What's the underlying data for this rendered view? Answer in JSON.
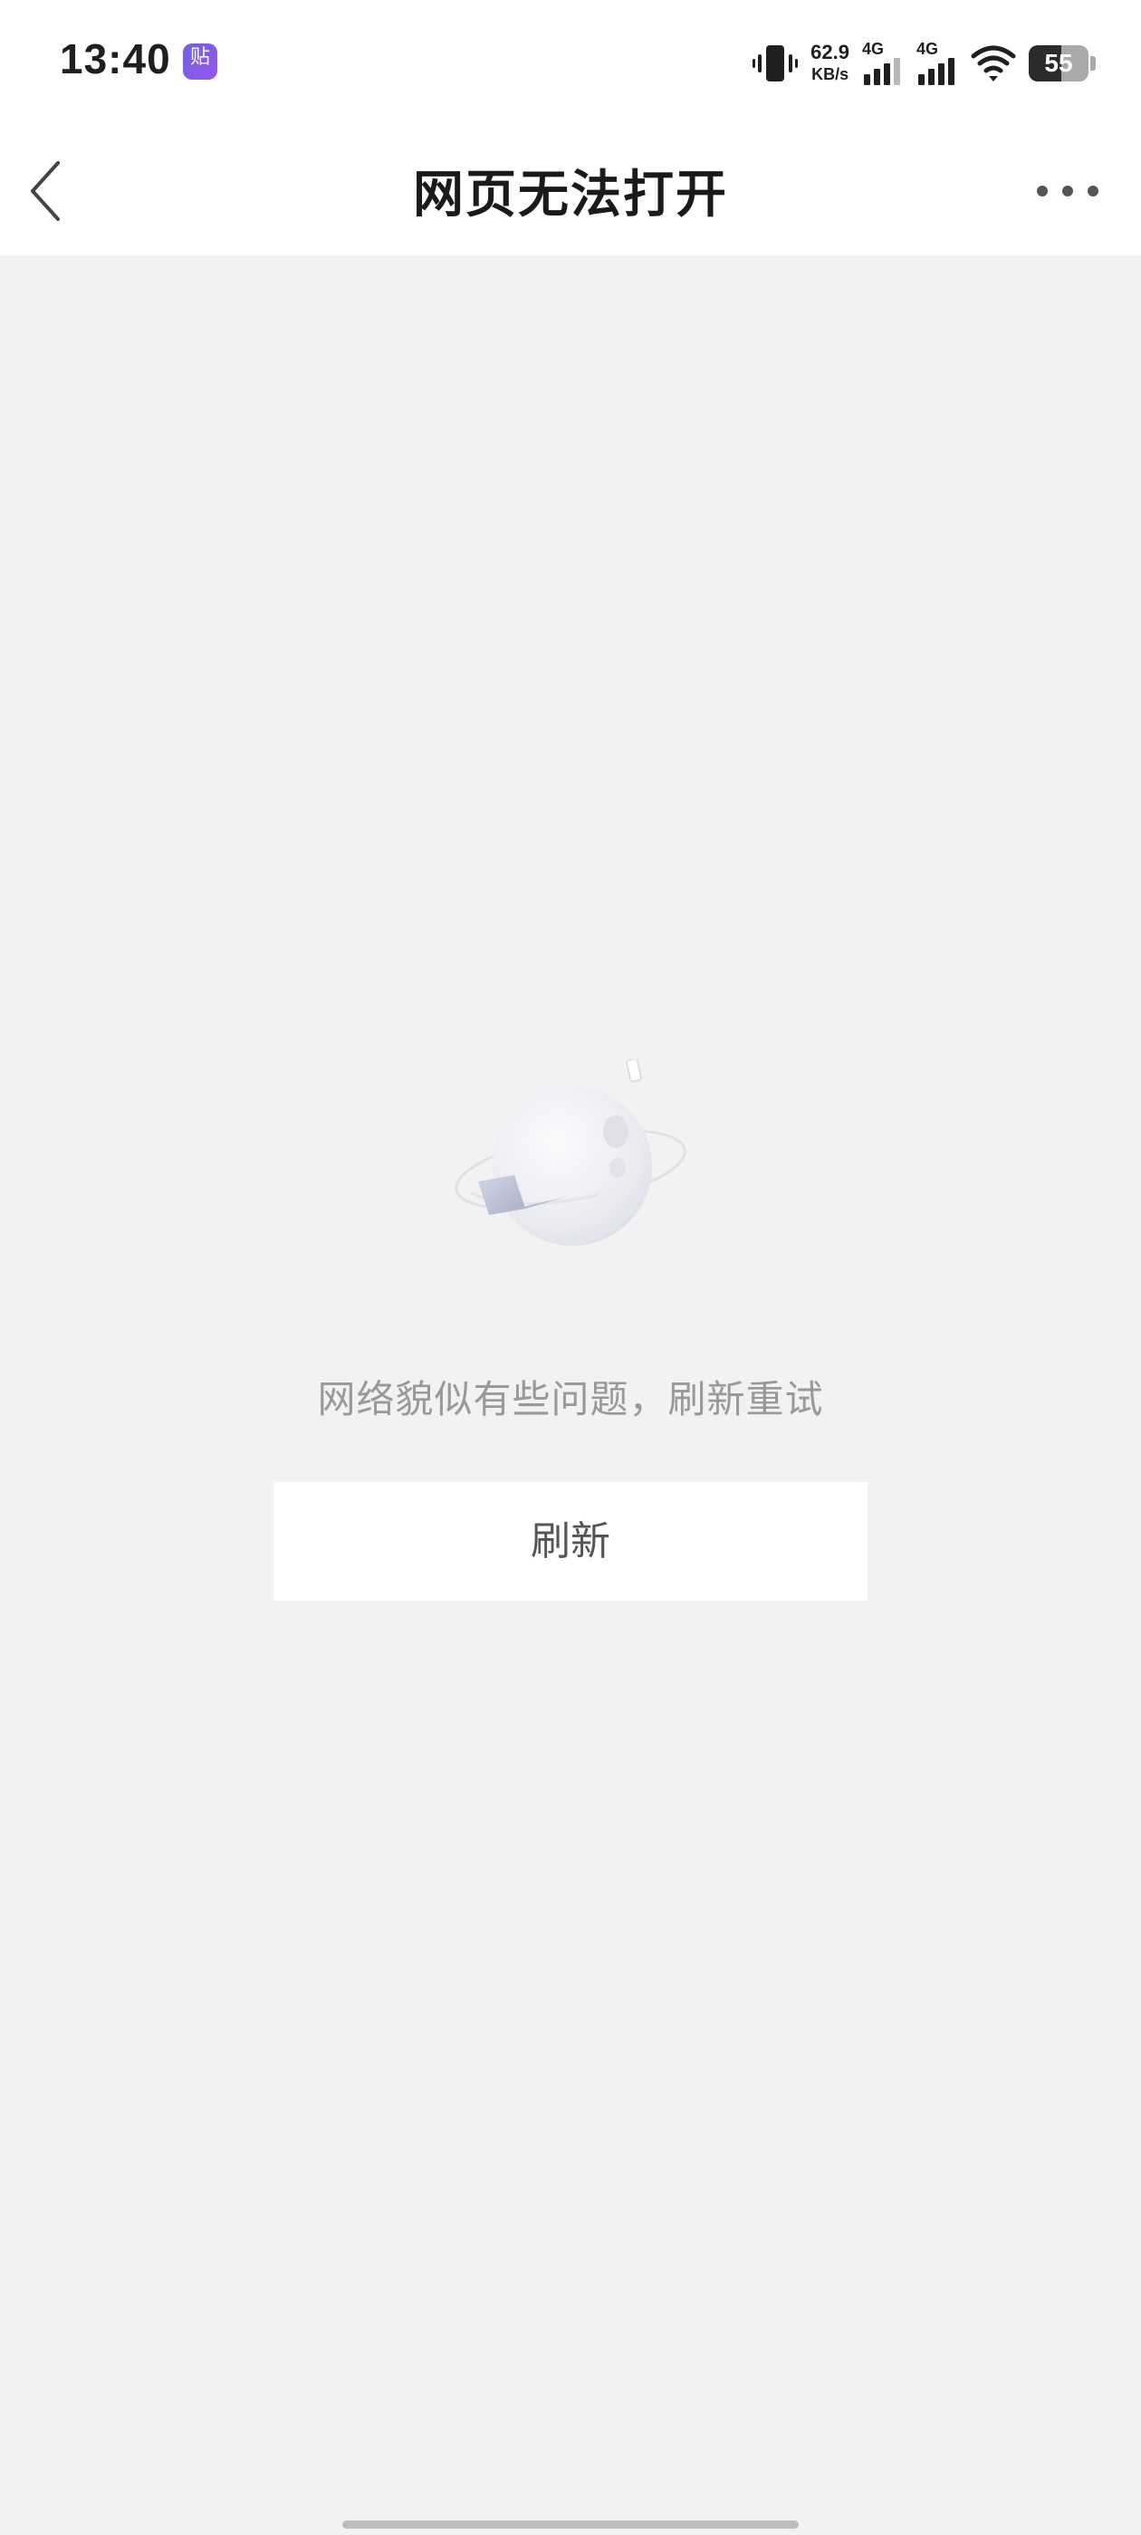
{
  "status_bar": {
    "time": "13:40",
    "app_icon_glyph": "贴",
    "net_speed_value": "62.9",
    "net_speed_unit": "KB/s",
    "signal_1_label": "4G",
    "signal_2_label": "4G",
    "battery_level": "55",
    "icons": [
      "vibrate-icon",
      "signal-icon",
      "wifi-icon",
      "battery-icon"
    ]
  },
  "header": {
    "title": "网页无法打开",
    "back_icon": "chevron-left-icon",
    "more_icon": "more-horizontal-icon"
  },
  "content": {
    "illustration": "planet-with-laptop-illustration",
    "message": "网络貌似有些问题，刷新重试",
    "refresh_label": "刷新"
  },
  "colors": {
    "background": "#f2f2f2",
    "bar_background": "#ffffff",
    "title_text": "#1a1a1a",
    "message_text": "#999999",
    "button_text": "#555555"
  }
}
